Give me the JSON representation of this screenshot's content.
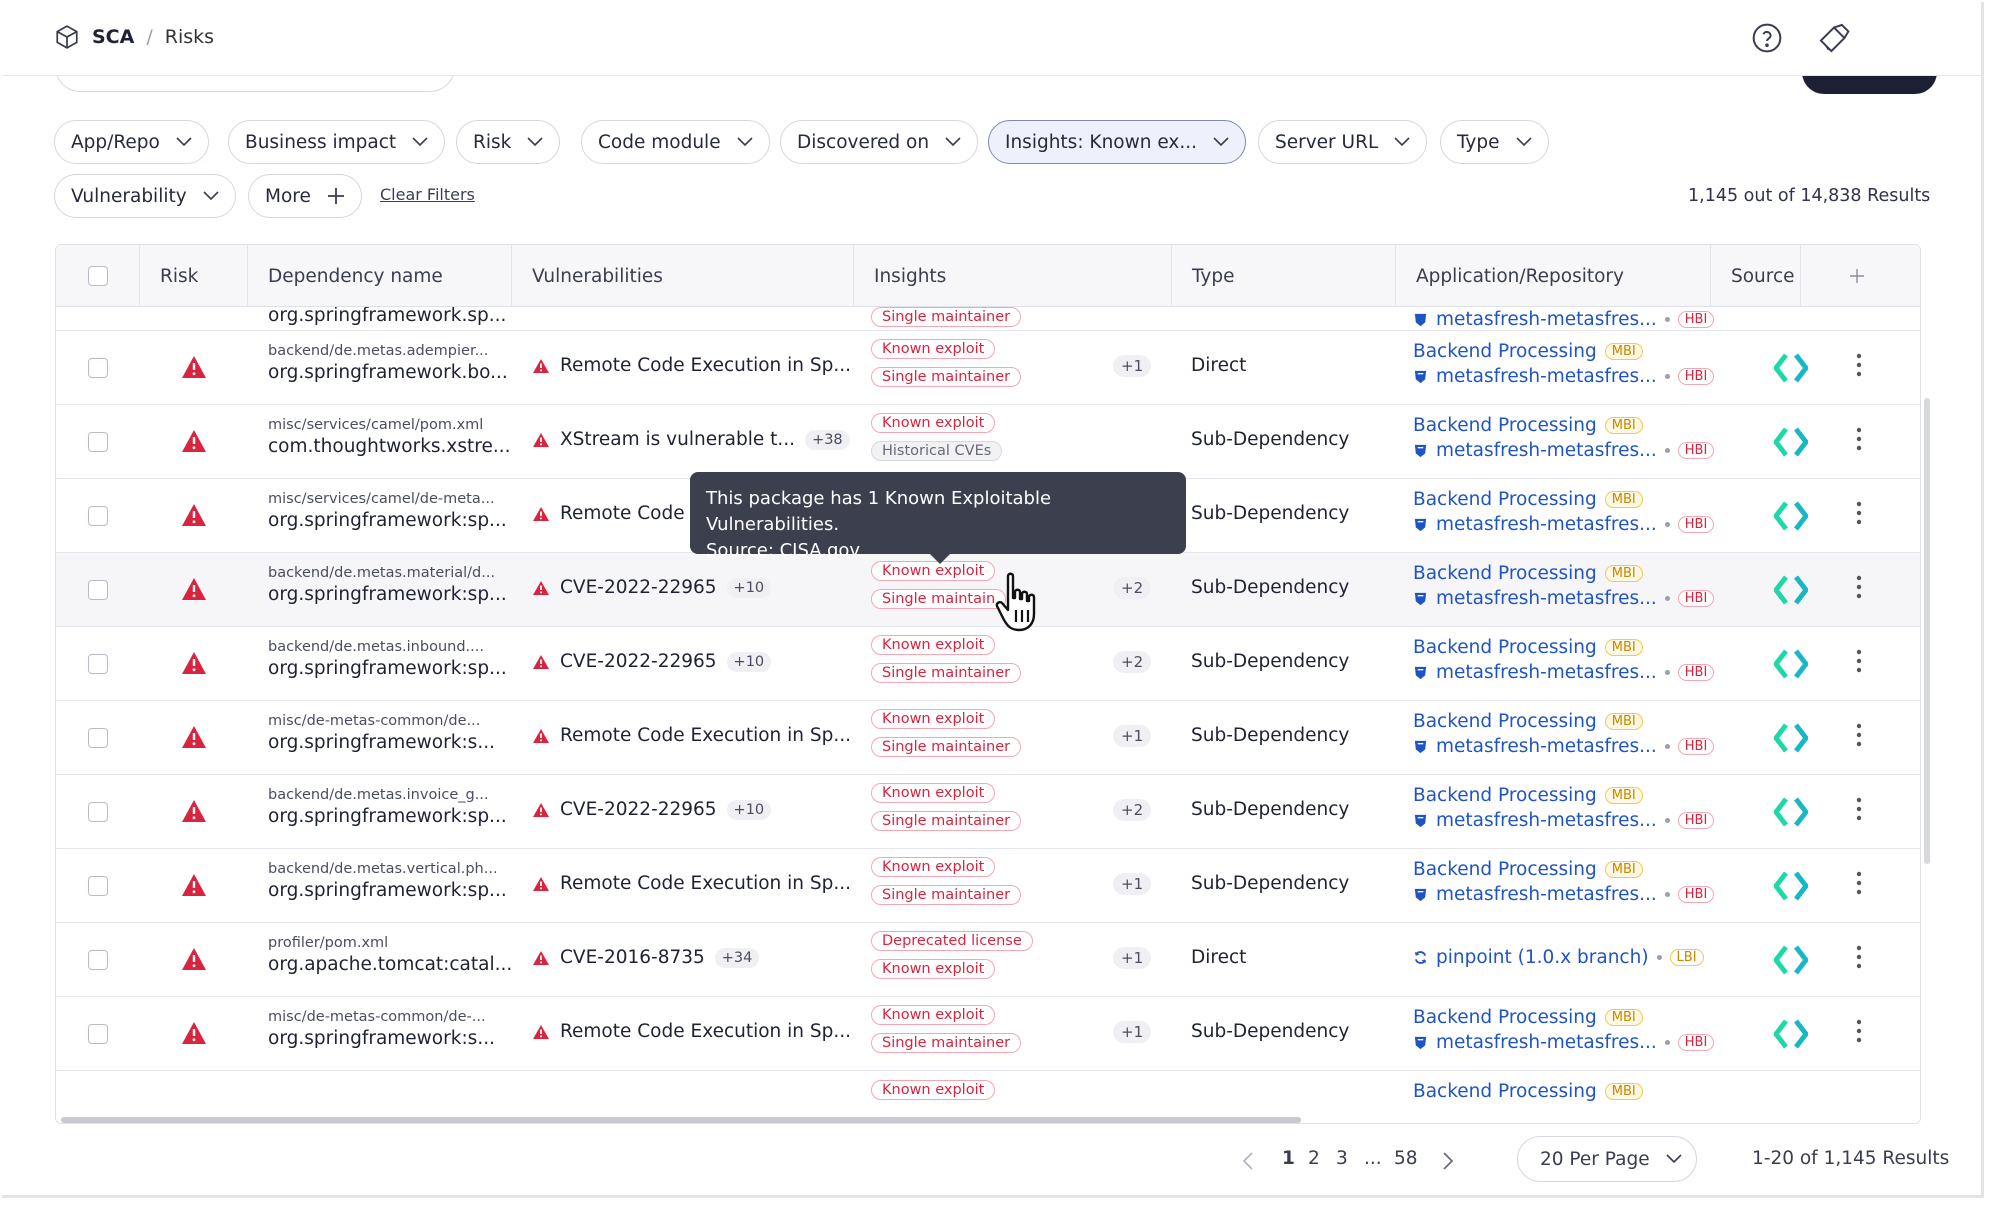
{
  "breadcrumb": {
    "root": "SCA",
    "separator": "/",
    "current": "Risks"
  },
  "filters": [
    {
      "label": "App/Repo",
      "active": false
    },
    {
      "label": "Business impact",
      "active": false
    },
    {
      "label": "Risk",
      "active": false
    },
    {
      "label": "Code module",
      "active": false
    },
    {
      "label": "Discovered on",
      "active": false
    },
    {
      "label": "Insights: Known ex...",
      "active": true
    },
    {
      "label": "Server URL",
      "active": false
    },
    {
      "label": "Type",
      "active": false
    },
    {
      "label": "Vulnerability",
      "active": false
    },
    {
      "label": "More",
      "active": false
    }
  ],
  "clear_filters": "Clear Filters",
  "results_top": "1,145 out of 14,838 Results",
  "columns": [
    "Risk",
    "Dependency name",
    "Vulnerabilities",
    "Insights",
    "Type",
    "Application/Repository",
    "Source"
  ],
  "partial_top": {
    "dep_name": "org.springframework.sp...",
    "insight": "Single maintainer",
    "repo": "metasfresh-metasfres...",
    "repo_pill": "HBI"
  },
  "rows": [
    {
      "path": "backend/de.metas.adempier...",
      "name": "org.springframework.bo...",
      "vuln": "Remote Code Execution in Sp...",
      "vuln_count": "",
      "insights": [
        "Known exploit",
        "Single maintainer"
      ],
      "insights_more": "+1",
      "type": "Direct",
      "app": "Backend Processing",
      "app_pill": "MBI",
      "repo": "metasfresh-metasfres...",
      "repo_pill": "HBI"
    },
    {
      "path": "misc/services/camel/pom.xml",
      "name": "com.thoughtworks.xstre...",
      "vuln": "XStream is vulnerable t...",
      "vuln_count": "+38",
      "insights": [
        "Known exploit",
        "Historical CVEs"
      ],
      "insights_more": "",
      "type": "Sub-Dependency",
      "app": "Backend Processing",
      "app_pill": "MBI",
      "repo": "metasfresh-metasfres...",
      "repo_pill": "HBI"
    },
    {
      "path": "misc/services/camel/de-meta...",
      "name": "org.springframework:sp...",
      "vuln": "Remote Code E",
      "vuln_count": "",
      "insights": [],
      "insights_more": "",
      "type": "Sub-Dependency",
      "app": "Backend Processing",
      "app_pill": "MBI",
      "repo": "metasfresh-metasfres...",
      "repo_pill": "HBI"
    },
    {
      "path": "backend/de.metas.material/d...",
      "name": "org.springframework:sp...",
      "vuln": "CVE-2022-22965",
      "vuln_count": "+10",
      "insights": [
        "Known exploit",
        "Single maintain"
      ],
      "insights_more": "+2",
      "type": "Sub-Dependency",
      "app": "Backend Processing",
      "app_pill": "MBI",
      "repo": "metasfresh-metasfres...",
      "repo_pill": "HBI"
    },
    {
      "path": "backend/de.metas.inbound....",
      "name": "org.springframework:sp...",
      "vuln": "CVE-2022-22965",
      "vuln_count": "+10",
      "insights": [
        "Known exploit",
        "Single maintainer"
      ],
      "insights_more": "+2",
      "type": "Sub-Dependency",
      "app": "Backend Processing",
      "app_pill": "MBI",
      "repo": "metasfresh-metasfres...",
      "repo_pill": "HBI"
    },
    {
      "path": "misc/de-metas-common/de...",
      "name": "org.springframework:s...",
      "vuln": "Remote Code Execution in Sp...",
      "vuln_count": "",
      "insights": [
        "Known exploit",
        "Single maintainer"
      ],
      "insights_more": "+1",
      "type": "Sub-Dependency",
      "app": "Backend Processing",
      "app_pill": "MBI",
      "repo": "metasfresh-metasfres...",
      "repo_pill": "HBI"
    },
    {
      "path": "backend/de.metas.invoice_g...",
      "name": "org.springframework:sp...",
      "vuln": "CVE-2022-22965",
      "vuln_count": "+10",
      "insights": [
        "Known exploit",
        "Single maintainer"
      ],
      "insights_more": "+2",
      "type": "Sub-Dependency",
      "app": "Backend Processing",
      "app_pill": "MBI",
      "repo": "metasfresh-metasfres...",
      "repo_pill": "HBI"
    },
    {
      "path": "backend/de.metas.vertical.ph...",
      "name": "org.springframework:sp...",
      "vuln": "Remote Code Execution in Sp...",
      "vuln_count": "",
      "insights": [
        "Known exploit",
        "Single maintainer"
      ],
      "insights_more": "+1",
      "type": "Sub-Dependency",
      "app": "Backend Processing",
      "app_pill": "MBI",
      "repo": "metasfresh-metasfres...",
      "repo_pill": "HBI"
    },
    {
      "path": "profiler/pom.xml",
      "name": "org.apache.tomcat:catal...",
      "vuln": "CVE-2016-8735",
      "vuln_count": "+34",
      "insights": [
        "Deprecated license",
        "Known exploit"
      ],
      "insights_more": "+1",
      "type": "Direct",
      "app": "",
      "app_pill": "",
      "repo": "pinpoint (1.0.x branch)",
      "repo_pill": "LBI"
    },
    {
      "path": "misc/de-metas-common/de-...",
      "name": "org.springframework:s...",
      "vuln": "Remote Code Execution in Sp...",
      "vuln_count": "",
      "insights": [
        "Known exploit",
        "Single maintainer"
      ],
      "insights_more": "+1",
      "type": "Sub-Dependency",
      "app": "Backend Processing",
      "app_pill": "MBI",
      "repo": "metasfresh-metasfres...",
      "repo_pill": "HBI"
    }
  ],
  "partial_bottom": {
    "insight": "Known exploit",
    "app": "Backend Processing",
    "app_pill": "MBI"
  },
  "tooltip": {
    "line1": "This package has 1 Known Exploitable Vulnerabilities.",
    "line2": "Source: CISA.gov"
  },
  "pagination": {
    "pages": [
      "1",
      "2",
      "3",
      "...",
      "58"
    ],
    "current": "1",
    "per_page": "20 Per Page",
    "results": "1-20 of 1,145 Results"
  },
  "colors": {
    "accent": "#1f54c4",
    "risk_red": "#d8243f",
    "source_green": "#1fd8a8",
    "mbi_amber": "#c88800"
  }
}
